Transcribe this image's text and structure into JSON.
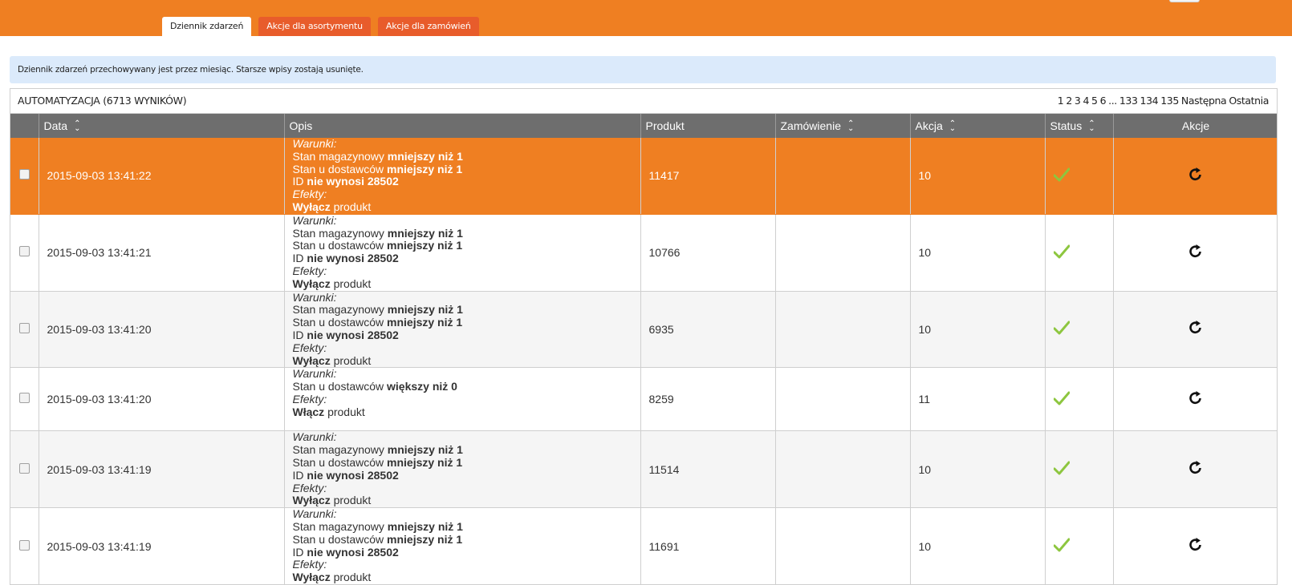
{
  "tabs": [
    {
      "label": "Dziennik zdarzeń",
      "active": true
    },
    {
      "label": "Akcje dla asortymentu",
      "active": false
    },
    {
      "label": "Akcje dla zamówień",
      "active": false
    }
  ],
  "notice": "Dziennik zdarzeń przechowywany jest przez miesiąc. Starsze wpisy zostają usunięte.",
  "panel": {
    "title": "AUTOMATYZACJA (6713 WYNIKÓW)",
    "pagination": [
      "1",
      "2",
      "3",
      "4",
      "5",
      "6",
      "...",
      "133",
      "134",
      "135",
      "Następna",
      "Ostatnia"
    ]
  },
  "table": {
    "columns": [
      "Data",
      "Opis",
      "Produkt",
      "Zamówienie",
      "Akcja",
      "Status",
      "Akcje"
    ],
    "rows": [
      {
        "date": "2015-09-03 13:41:22",
        "produkt": "11417",
        "zamowienie": "",
        "akcja": "10",
        "highlighted": true,
        "desc": {
          "cond_label": "Warunki:",
          "lines": [
            [
              "Stan magazynowy ",
              "mniejszy niż 1"
            ],
            [
              "Stan u dostawców ",
              "mniejszy niż 1"
            ],
            [
              "ID ",
              "nie wynosi 28502"
            ]
          ],
          "eff_label": "Efekty:",
          "effect": [
            "Wyłącz",
            " produkt"
          ]
        }
      },
      {
        "date": "2015-09-03 13:41:21",
        "produkt": "10766",
        "zamowienie": "",
        "akcja": "10",
        "highlighted": false,
        "desc": {
          "cond_label": "Warunki:",
          "lines": [
            [
              "Stan magazynowy ",
              "mniejszy niż 1"
            ],
            [
              "Stan u dostawców ",
              "mniejszy niż 1"
            ],
            [
              "ID ",
              "nie wynosi 28502"
            ]
          ],
          "eff_label": "Efekty:",
          "effect": [
            "Wyłącz",
            " produkt"
          ]
        }
      },
      {
        "date": "2015-09-03 13:41:20",
        "produkt": "6935",
        "zamowienie": "",
        "akcja": "10",
        "highlighted": false,
        "desc": {
          "cond_label": "Warunki:",
          "lines": [
            [
              "Stan magazynowy ",
              "mniejszy niż 1"
            ],
            [
              "Stan u dostawców ",
              "mniejszy niż 1"
            ],
            [
              "ID ",
              "nie wynosi 28502"
            ]
          ],
          "eff_label": "Efekty:",
          "effect": [
            "Wyłącz",
            " produkt"
          ]
        }
      },
      {
        "date": "2015-09-03 13:41:20",
        "produkt": "8259",
        "zamowienie": "",
        "akcja": "11",
        "highlighted": false,
        "desc": {
          "cond_label": "Warunki:",
          "lines": [
            [
              "Stan u dostawców ",
              "większy niż 0"
            ]
          ],
          "eff_label": "Efekty:",
          "effect": [
            "Włącz",
            " produkt"
          ]
        }
      },
      {
        "date": "2015-09-03 13:41:19",
        "produkt": "11514",
        "zamowienie": "",
        "akcja": "10",
        "highlighted": false,
        "desc": {
          "cond_label": "Warunki:",
          "lines": [
            [
              "Stan magazynowy ",
              "mniejszy niż 1"
            ],
            [
              "Stan u dostawców ",
              "mniejszy niż 1"
            ],
            [
              "ID ",
              "nie wynosi 28502"
            ]
          ],
          "eff_label": "Efekty:",
          "effect": [
            "Wyłącz",
            " produkt"
          ]
        }
      },
      {
        "date": "2015-09-03 13:41:19",
        "produkt": "11691",
        "zamowienie": "",
        "akcja": "10",
        "highlighted": false,
        "desc": {
          "cond_label": "Warunki:",
          "lines": [
            [
              "Stan magazynowy ",
              "mniejszy niż 1"
            ],
            [
              "Stan u dostawców ",
              "mniejszy niż 1"
            ],
            [
              "ID ",
              "nie wynosi 28502"
            ]
          ],
          "eff_label": "Efekty:",
          "effect": [
            "Wyłącz",
            " produkt"
          ]
        }
      }
    ]
  },
  "icons": {
    "status": "check-icon",
    "action": "refresh-icon",
    "sort": "sort-icon"
  },
  "colors": {
    "brand": "#ef7f22",
    "tab_inactive": "#e85c2b",
    "notice_bg": "#dbeafb",
    "header_bg": "#6e6e6e",
    "check": "#8dc63f"
  }
}
